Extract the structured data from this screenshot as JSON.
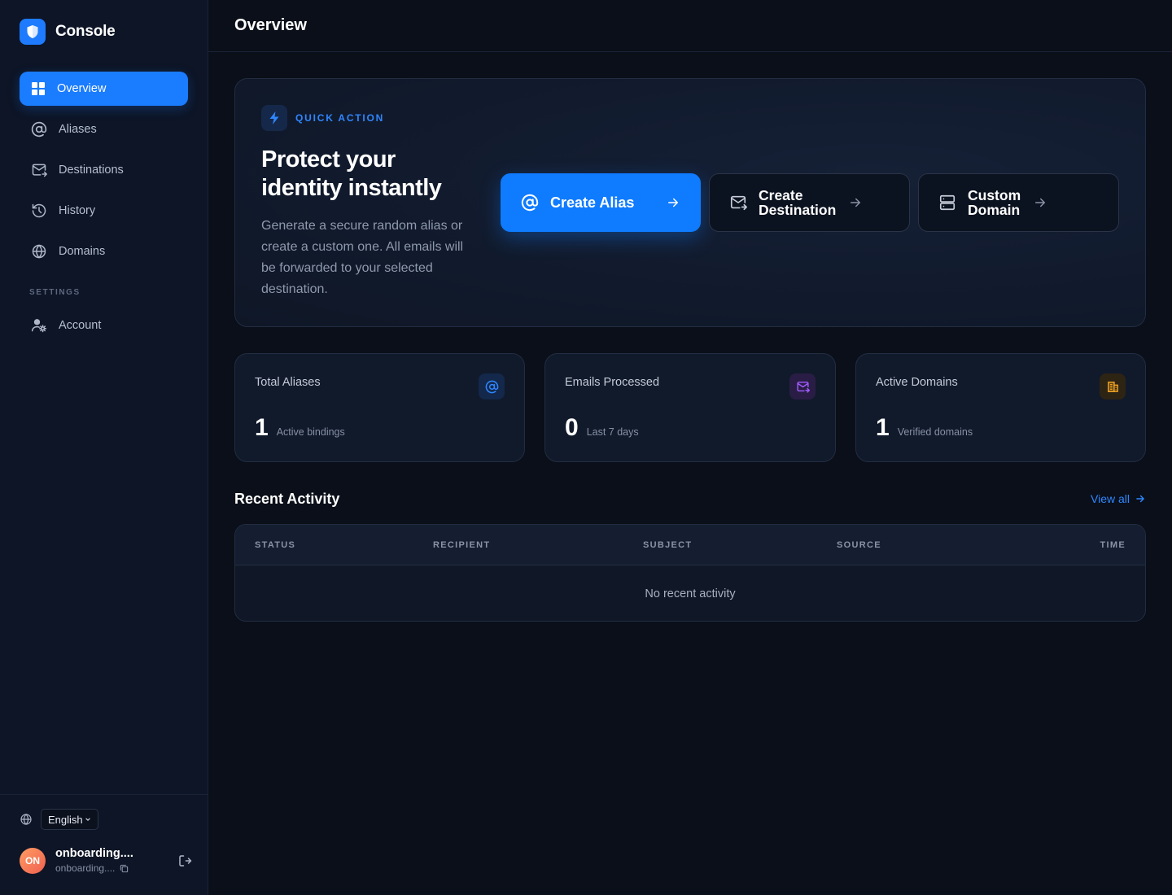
{
  "brand": {
    "name": "Console"
  },
  "nav": {
    "items": [
      {
        "label": "Overview",
        "icon": "grid-icon",
        "active": true
      },
      {
        "label": "Aliases",
        "icon": "at-sign-icon",
        "active": false
      },
      {
        "label": "Destinations",
        "icon": "mail-forward-icon",
        "active": false
      },
      {
        "label": "History",
        "icon": "history-icon",
        "active": false
      },
      {
        "label": "Domains",
        "icon": "globe-icon",
        "active": false
      }
    ],
    "settings_label": "SETTINGS",
    "settings_items": [
      {
        "label": "Account",
        "icon": "user-gear-icon"
      }
    ]
  },
  "footer": {
    "language": "English",
    "user": {
      "initials": "ON",
      "name": "onboarding....",
      "email": "onboarding...."
    }
  },
  "header": {
    "title": "Overview"
  },
  "quick_action": {
    "tag": "QUICK ACTION",
    "title": "Protect your identity instantly",
    "description": "Generate a secure random alias or create a custom one. All emails will be forwarded to your selected destination.",
    "actions": [
      {
        "label": "Create Alias",
        "icon": "at-sign-icon",
        "primary": true
      },
      {
        "label": "Create Destination",
        "icon": "mail-forward-icon",
        "primary": false
      },
      {
        "label": "Custom Domain",
        "icon": "server-icon",
        "primary": false
      }
    ]
  },
  "stats": [
    {
      "label": "Total Aliases",
      "value": "1",
      "sub": "Active bindings",
      "icon": "at-sign-icon",
      "color": "#2f86ff"
    },
    {
      "label": "Emails Processed",
      "value": "0",
      "sub": "Last 7 days",
      "icon": "mail-forward-icon",
      "color": "#a35cff"
    },
    {
      "label": "Active Domains",
      "value": "1",
      "sub": "Verified domains",
      "icon": "building-icon",
      "color": "#f5a623"
    }
  ],
  "activity": {
    "title": "Recent Activity",
    "view_all": "View all",
    "columns": [
      "STATUS",
      "RECIPIENT",
      "SUBJECT",
      "SOURCE",
      "TIME"
    ],
    "empty_text": "No recent activity"
  },
  "colors": {
    "accent": "#1a7cff",
    "background": "#0a0f19",
    "sidebar": "#0d1526"
  }
}
